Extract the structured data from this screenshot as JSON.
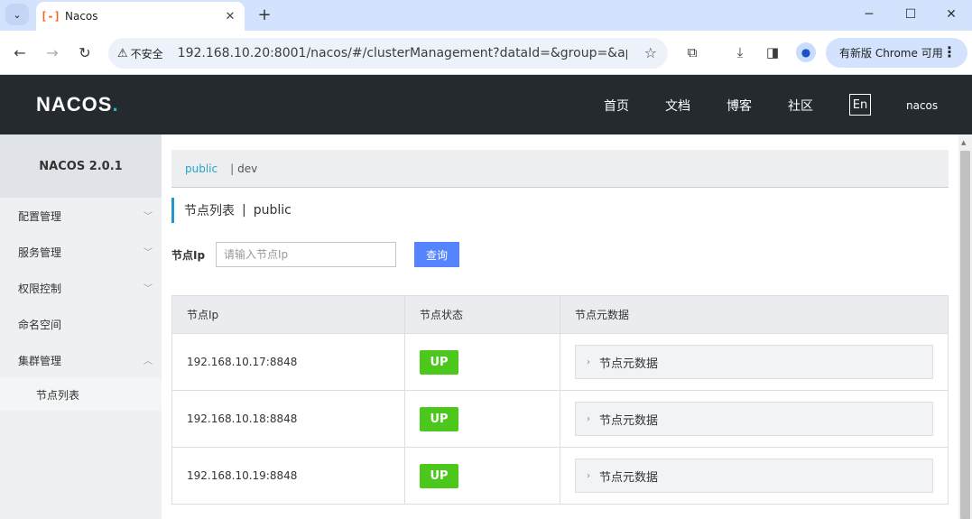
{
  "browser": {
    "tab_title": "Nacos",
    "security_label": "不安全",
    "url": "192.168.10.20:8001/nacos/#/clusterManagement?dataId=&group=&app...",
    "update_label": "有新版 Chrome 可用"
  },
  "header": {
    "logo": "NACOS",
    "logo_dot": ".",
    "nav": [
      "首页",
      "文档",
      "博客",
      "社区"
    ],
    "lang": "En",
    "user": "nacos"
  },
  "sidebar": {
    "title": "NACOS 2.0.1",
    "items": [
      {
        "label": "配置管理"
      },
      {
        "label": "服务管理"
      },
      {
        "label": "权限控制"
      },
      {
        "label": "命名空间"
      },
      {
        "label": "集群管理"
      }
    ],
    "subitems": [
      {
        "label": "节点列表"
      }
    ]
  },
  "namespace": {
    "active": "public",
    "separator": "|",
    "other": "dev"
  },
  "page": {
    "title": "节点列表",
    "title_sep": "|",
    "namespace": "public"
  },
  "search": {
    "label": "节点Ip",
    "placeholder": "请输入节点Ip",
    "button": "查询"
  },
  "table": {
    "columns": [
      "节点Ip",
      "节点状态",
      "节点元数据"
    ],
    "rows": [
      {
        "ip": "192.168.10.17:8848",
        "status": "UP",
        "meta": "节点元数据"
      },
      {
        "ip": "192.168.10.18:8848",
        "status": "UP",
        "meta": "节点元数据"
      },
      {
        "ip": "192.168.10.19:8848",
        "status": "UP",
        "meta": "节点元数据"
      }
    ]
  },
  "colors": {
    "header_bg": "#252a2f",
    "accent": "#27a3c9",
    "primary_button": "#5584ff",
    "status_up": "#4cc71c"
  }
}
